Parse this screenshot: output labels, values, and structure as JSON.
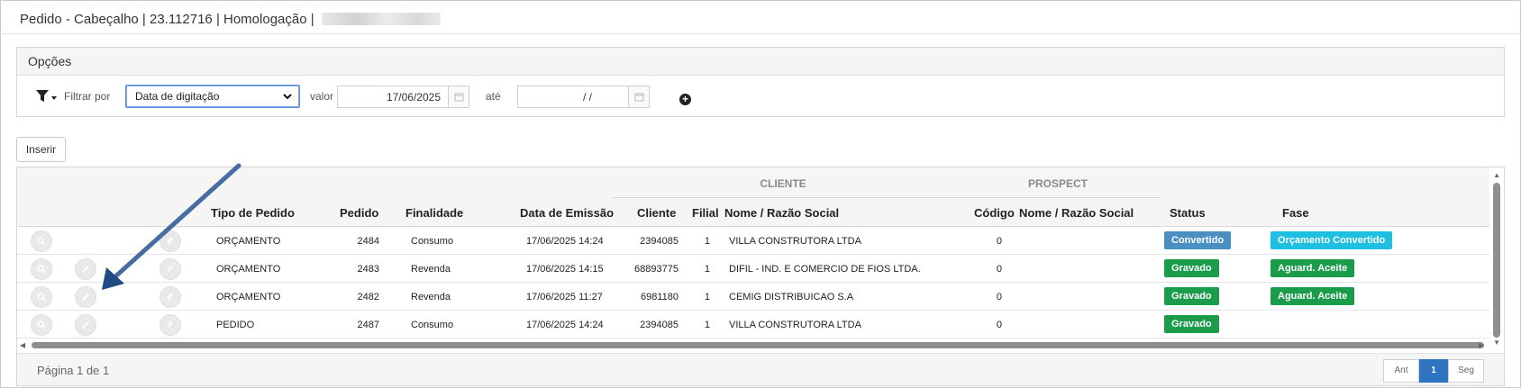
{
  "header": {
    "title": "Pedido - Cabeçalho | 23.112716 | Homologação |"
  },
  "options": {
    "title": "Opções",
    "filter_label": "Filtrar por",
    "filter_value": "Data de digitação",
    "valor_label": "valor",
    "date_from": "17/06/2025",
    "ate_label": "até",
    "date_to": "/ /"
  },
  "buttons": {
    "insert": "Inserir"
  },
  "table": {
    "groups": {
      "cliente": "CLIENTE",
      "prospect": "PROSPECT"
    },
    "headers": {
      "tipo": "Tipo de Pedido",
      "pedido": "Pedido",
      "finalidade": "Finalidade",
      "emissao": "Data de Emissão",
      "cliente": "Cliente",
      "filial": "Filial",
      "nome": "Nome / Razão Social",
      "codigo": "Código",
      "pnome": "Nome / Razão Social",
      "status": "Status",
      "fase": "Fase"
    },
    "rows": [
      {
        "tipo": "ORÇAMENTO",
        "pedido": "2484",
        "finalidade": "Consumo",
        "emissao": "17/06/2025 14:24",
        "cliente": "2394085",
        "filial": "1",
        "nome": "VILLA CONSTRUTORA LTDA",
        "codigo": "0",
        "status": "Convertido",
        "fase": "Orçamento Convertido"
      },
      {
        "tipo": "ORÇAMENTO",
        "pedido": "2483",
        "finalidade": "Revenda",
        "emissao": "17/06/2025 14:15",
        "cliente": "68893775",
        "filial": "1",
        "nome": "DIFIL - IND. E COMERCIO DE FIOS LTDA.",
        "codigo": "0",
        "status": "Gravado",
        "fase": "Aguard. Aceite"
      },
      {
        "tipo": "ORÇAMENTO",
        "pedido": "2482",
        "finalidade": "Revenda",
        "emissao": "17/06/2025 11:27",
        "cliente": "6981180",
        "filial": "1",
        "nome": "CEMIG DISTRIBUICAO S.A",
        "codigo": "0",
        "status": "Gravado",
        "fase": "Aguard. Aceite"
      },
      {
        "tipo": "PEDIDO",
        "pedido": "2487",
        "finalidade": "Consumo",
        "emissao": "17/06/2025 14:24",
        "cliente": "2394085",
        "filial": "1",
        "nome": "VILLA CONSTRUTORA LTDA",
        "codigo": "0",
        "status": "Gravado",
        "fase": ""
      }
    ]
  },
  "pagination": {
    "info": "Página 1 de 1",
    "prev": "Ant",
    "current": "1",
    "next": "Seg"
  },
  "colors": {
    "convertido": "#4a90c2",
    "orcamento_convertido": "#1ebfe0",
    "gravado": "#1a9c4a",
    "aguard": "#1a9c4a",
    "annotation_arrow": "#1f4a86"
  }
}
